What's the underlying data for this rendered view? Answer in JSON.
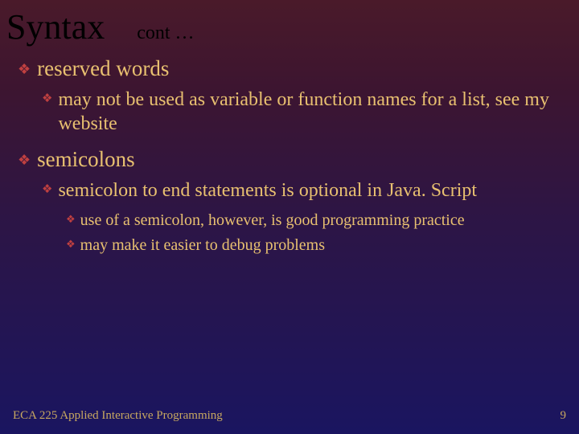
{
  "title": "Syntax",
  "cont": "cont …",
  "bullets": {
    "b1": "reserved words",
    "b1_1": "may not be used as variable or function names for a list, see my website",
    "b2": "semicolons",
    "b2_1": "semicolon to end statements is optional in Java. Script",
    "b2_1_1": "use of a semicolon, however, is good programming practice",
    "b2_1_2": "may make it easier to debug problems"
  },
  "footer": {
    "left": "ECA 225   Applied Interactive Programming",
    "right": "9"
  }
}
